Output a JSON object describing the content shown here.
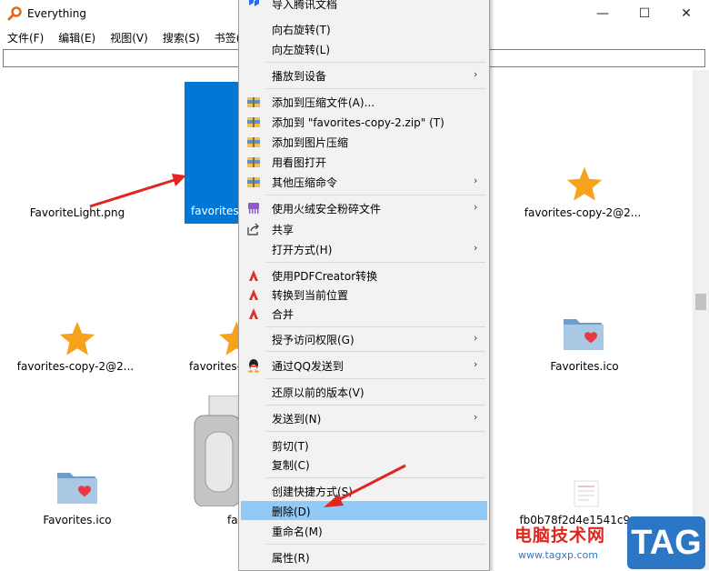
{
  "window": {
    "title": "Everything",
    "controls": {
      "minimize": "—",
      "maximize": "☐",
      "close": "✕"
    }
  },
  "menubar": [
    "文件(F)",
    "编辑(E)",
    "视图(V)",
    "搜索(S)",
    "书签(B)"
  ],
  "search": {
    "value": ""
  },
  "files": [
    {
      "name": "FavoriteLight.png",
      "icon": "none"
    },
    {
      "name": "favorites-copy-2@2...",
      "icon": "star-icon"
    },
    {
      "name": "favorites-copy-2@2...",
      "icon": "star-icon"
    },
    {
      "name": "favorites-",
      "icon": "star-icon"
    },
    {
      "name": "Favorites.ico",
      "icon": "folder-heart-icon"
    },
    {
      "name": "Favorites.ico",
      "icon": "folder-heart-icon"
    },
    {
      "name": "fa",
      "icon": "scanner-icon"
    },
    {
      "name": "fb0b78f2d4e1541c9...",
      "icon": "document-icon"
    }
  ],
  "selected_file": {
    "name": "favorites-"
  },
  "context_menu": [
    {
      "label": "导入腾讯文档",
      "icon": "tencent-docs-icon",
      "submenu": false
    },
    {
      "label": "向右旋转(T)",
      "icon": "none",
      "submenu": false
    },
    {
      "label": "向左旋转(L)",
      "icon": "none",
      "submenu": false
    },
    {
      "label": "播放到设备",
      "icon": "none",
      "submenu": true
    },
    {
      "label": "添加到压缩文件(A)...",
      "icon": "archive-icon",
      "submenu": false
    },
    {
      "label": "添加到 \"favorites-copy-2.zip\" (T)",
      "icon": "archive-icon",
      "submenu": false
    },
    {
      "label": "添加到图片压缩",
      "icon": "archive-icon",
      "submenu": false
    },
    {
      "label": "用看图打开",
      "icon": "archive-icon",
      "submenu": false
    },
    {
      "label": "其他压缩命令",
      "icon": "archive-icon",
      "submenu": true
    },
    {
      "label": "使用火绒安全粉碎文件",
      "icon": "shredder-icon",
      "submenu": true
    },
    {
      "label": "共享",
      "icon": "share-icon",
      "submenu": false
    },
    {
      "label": "打开方式(H)",
      "icon": "none",
      "submenu": true
    },
    {
      "label": "使用PDFCreator转换",
      "icon": "pdfcreator-icon",
      "submenu": false
    },
    {
      "label": "转换到当前位置",
      "icon": "pdfcreator-icon",
      "submenu": false
    },
    {
      "label": "合并",
      "icon": "pdfcreator-icon",
      "submenu": false
    },
    {
      "label": "授予访问权限(G)",
      "icon": "none",
      "submenu": true
    },
    {
      "label": "通过QQ发送到",
      "icon": "qq-icon",
      "submenu": true
    },
    {
      "label": "还原以前的版本(V)",
      "icon": "none",
      "submenu": false
    },
    {
      "label": "发送到(N)",
      "icon": "none",
      "submenu": true
    },
    {
      "label": "剪切(T)",
      "icon": "none",
      "submenu": false
    },
    {
      "label": "复制(C)",
      "icon": "none",
      "submenu": false
    },
    {
      "label": "创建快捷方式(S)",
      "icon": "none",
      "submenu": false
    },
    {
      "label": "删除(D)",
      "icon": "none",
      "submenu": false,
      "highlighted": true
    },
    {
      "label": "重命名(M)",
      "icon": "none",
      "submenu": false
    },
    {
      "label": "属性(R)",
      "icon": "none",
      "submenu": false
    }
  ],
  "submenu_arrow": "›",
  "watermark": {
    "site": "电脑技术网",
    "url": "www.tagxp.com",
    "logo": "TAG"
  },
  "colors": {
    "selection": "#0078d7",
    "menu_highlight": "#91c9f7",
    "arrow": "#e0261f",
    "star": "#f7a21b"
  }
}
